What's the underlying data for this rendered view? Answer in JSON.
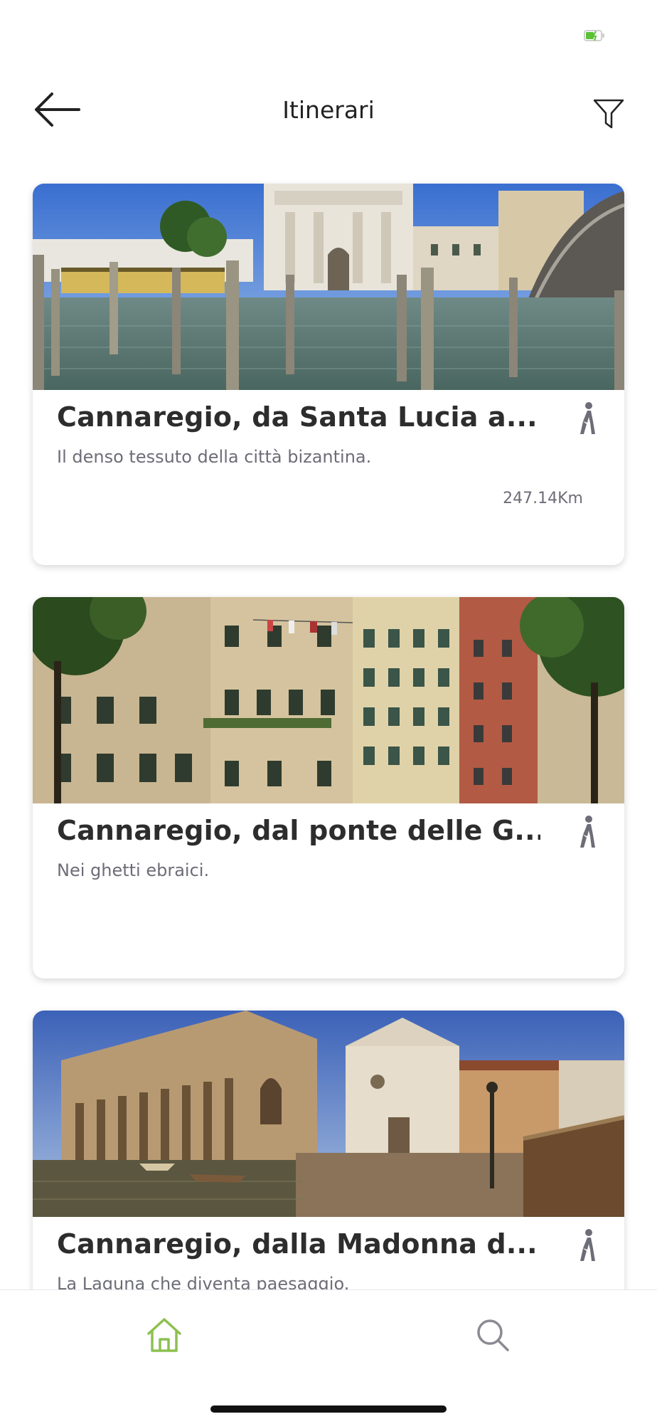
{
  "header": {
    "title": "Itinerari"
  },
  "icons": {
    "back": "arrow-left-icon",
    "filter": "funnel-icon",
    "walk": "walking-person-icon",
    "home": "home-icon",
    "search": "search-icon",
    "battery": "battery-charging-icon"
  },
  "colors": {
    "accent": "#8cc04f",
    "icon_gray": "#6d6d78",
    "battery": "#5bc236"
  },
  "itineraries": [
    {
      "title": "Cannaregio, da Santa Lucia a...",
      "subtitle": "Il denso tessuto della città bizantina.",
      "distance": "247.14Km"
    },
    {
      "title": "Cannaregio, dal ponte delle G...",
      "subtitle": "Nei ghetti ebraici.",
      "distance": ""
    },
    {
      "title": "Cannaregio, dalla Madonna d...",
      "subtitle": "La Laguna che diventa paesaggio.",
      "distance": ""
    }
  ],
  "bottom_nav": {
    "active": "home"
  }
}
